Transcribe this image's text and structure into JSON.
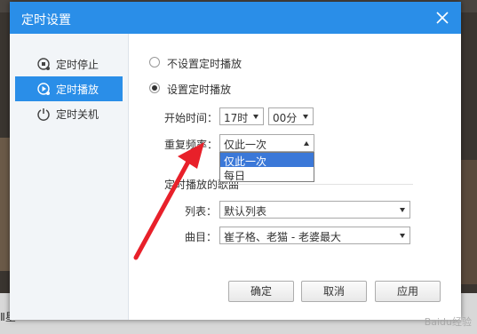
{
  "background": {
    "bottom_left_text": "Ⅱ星"
  },
  "dialog": {
    "title": "定时设置",
    "sidebar": {
      "items": [
        {
          "label": "定时停止",
          "icon": "timer-stop-icon",
          "active": false
        },
        {
          "label": "定时播放",
          "icon": "timer-play-icon",
          "active": true
        },
        {
          "label": "定时关机",
          "icon": "power-icon",
          "active": false
        }
      ]
    },
    "options": {
      "no_schedule": "不设置定时播放",
      "schedule": "设置定时播放",
      "selected": "schedule"
    },
    "start_time": {
      "label": "开始时间：",
      "hour": "17时",
      "minute": "00分"
    },
    "repeat": {
      "label": "重复频率：",
      "value": "仅此一次",
      "options": [
        "仅此一次",
        "每日"
      ],
      "highlighted": "仅此一次"
    },
    "songs": {
      "section_label": "定时播放的歌曲",
      "list_label": "列表：",
      "list_value": "默认列表",
      "track_label": "曲目：",
      "track_value": "崔子格、老猫 - 老婆最大"
    },
    "buttons": {
      "ok": "确定",
      "cancel": "取消",
      "apply": "应用"
    }
  },
  "annotation": {
    "arrow_color": "#e8202a"
  },
  "watermark": "Baidu经验"
}
